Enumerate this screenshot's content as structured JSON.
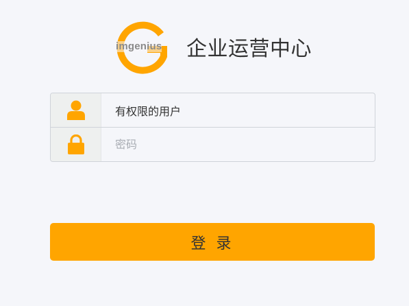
{
  "brand": {
    "logo_text": "imgenius",
    "title": "企业运营中心"
  },
  "form": {
    "username": {
      "value": "有权限的用户",
      "placeholder": "",
      "icon": "user-icon"
    },
    "password": {
      "value": "",
      "placeholder": "密码",
      "icon": "lock-icon"
    },
    "submit_label": "登 录"
  },
  "colors": {
    "accent": "#ffa500",
    "background": "#f5f6fa",
    "icon_cell_bg": "#eef0ef",
    "border": "#cfd3d9",
    "text": "#333333",
    "placeholder": "#a9adb4"
  }
}
